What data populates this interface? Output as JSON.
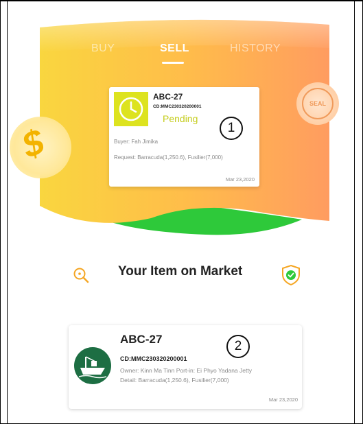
{
  "tabs": [
    {
      "label": "BUY"
    },
    {
      "label": "SELL"
    },
    {
      "label": "HISTORY"
    }
  ],
  "active_tab": "SELL",
  "pending_card": {
    "title": "ABC-27",
    "code": "CD:MMC230320200001",
    "status": "Pending",
    "buyer": "Buyer: Fah Jimika",
    "request": "Request: Barracuda(1,250.6), Fusilier(7,000)",
    "date": "Mar 23,2020",
    "badge_icon": "clock-icon"
  },
  "annotations": {
    "one": "1",
    "two": "2"
  },
  "market_section": {
    "title": "Your Item on Market",
    "left_icon": "search-icon",
    "right_icon": "shield-check-icon"
  },
  "market_item": {
    "title": "ABC-27",
    "code": "CD:MMC230320200001",
    "owner": "Owner: Kinn Ma Tinn   Port-in: Ei Phyo Yadana Jetty",
    "detail": "Detail: Barracuda(1,250.6), Fusilier(7,000)",
    "date": "Mar 23,2020",
    "avatar_icon": "fishing-boat-icon"
  },
  "colors": {
    "gradient_start": "#f9d63f",
    "gradient_end": "#ff9e5e",
    "pending": "#c4cc1a",
    "badge": "#dde31f",
    "boat_circle": "#1d6e43",
    "green_wave": "#2ec93a"
  }
}
